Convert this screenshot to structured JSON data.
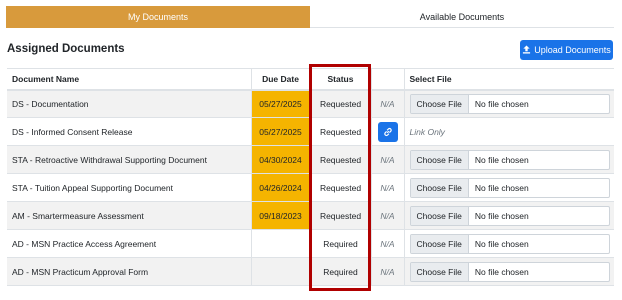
{
  "tabs": [
    {
      "label": "My Documents",
      "active": true
    },
    {
      "label": "Available Documents",
      "active": false
    }
  ],
  "section_title": "Assigned Documents",
  "upload_button": {
    "label": "Upload Documents",
    "icon": "upload-icon"
  },
  "columns": {
    "name": "Document Name",
    "due": "Due Date",
    "status": "Status",
    "na": "",
    "file": "Select File"
  },
  "file_input": {
    "button": "Choose File",
    "placeholder": "No file chosen"
  },
  "rows": [
    {
      "name": "DS - Documentation",
      "due": "05/27/2025",
      "status": "Requested",
      "na": "N/A",
      "file": "input"
    },
    {
      "name": "DS - Informed Consent Release",
      "due": "05/27/2025",
      "status": "Requested",
      "na": "",
      "file": "link",
      "file_text": "Link Only"
    },
    {
      "name": "STA - Retroactive Withdrawal Supporting Document",
      "due": "04/30/2024",
      "status": "Requested",
      "na": "N/A",
      "file": "input"
    },
    {
      "name": "STA - Tuition Appeal Supporting Document",
      "due": "04/26/2024",
      "status": "Requested",
      "na": "N/A",
      "file": "input"
    },
    {
      "name": "AM - Smartermeasure Assessment",
      "due": "09/18/2023",
      "status": "Requested",
      "na": "N/A",
      "file": "input"
    },
    {
      "name": "AD - MSN Practice Access Agreement",
      "due": "",
      "status": "Required",
      "na": "N/A",
      "file": "input"
    },
    {
      "name": "AD - MSN Practicum Approval Form",
      "due": "",
      "status": "Required",
      "na": "N/A",
      "file": "input"
    }
  ],
  "colors": {
    "tab_active": "#d89a3c",
    "due_highlight": "#f5b400",
    "primary": "#1a73e8",
    "annotation_border": "#b00000"
  }
}
